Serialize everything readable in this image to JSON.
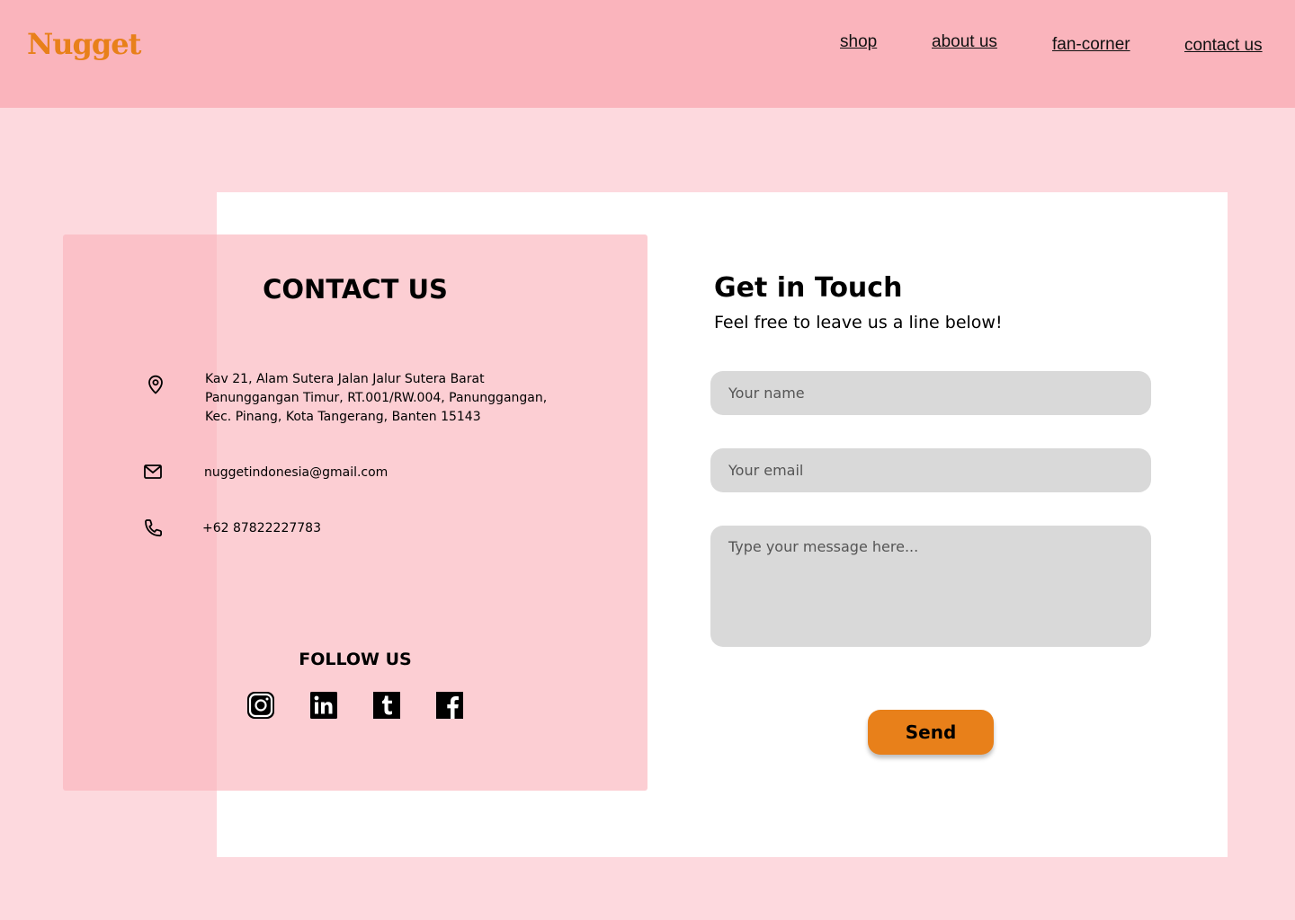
{
  "header": {
    "logo": "Nugget",
    "nav": {
      "shop": "shop",
      "about": "about us",
      "fan_corner": "fan-corner",
      "contact": "contact us"
    }
  },
  "contact_panel": {
    "title": "CONTACT US",
    "address": {
      "icon": "location-pin-icon",
      "lines": [
        "Kav 21, Alam Sutera Jalan Jalur Sutera Barat",
        "Panunggangan Timur, RT.001/RW.004, Panunggangan,",
        "Kec. Pinang, Kota Tangerang, Banten 15143"
      ]
    },
    "email": {
      "icon": "mail-icon",
      "value": "nuggetindonesia@gmail.com"
    },
    "phone": {
      "icon": "phone-icon",
      "value": "+62 87822227783"
    },
    "follow_title": "FOLLOW US",
    "socials": [
      "instagram-icon",
      "linkedin-icon",
      "tumblr-icon",
      "facebook-icon"
    ]
  },
  "form": {
    "title": "Get in Touch",
    "subtitle": "Feel free to leave us a line below!",
    "name_placeholder": "Your name",
    "email_placeholder": "Your email",
    "message_placeholder": "Type your message here...",
    "send_label": "Send"
  },
  "colors": {
    "page_bg": "#fdd9de",
    "header_bg": "#fab4bc",
    "accent": "#e8801a",
    "field_bg": "#d9d9d9",
    "card_bg": "#ffffff"
  }
}
